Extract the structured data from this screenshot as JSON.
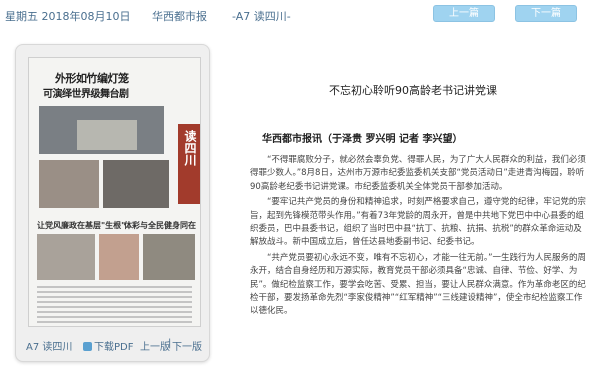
{
  "topbar": {
    "date": "星期五 2018年08月10日",
    "paper": "华西都市报",
    "edition": "-A7 读四川-",
    "prev_button": "上一篇",
    "next_button": "下一篇"
  },
  "thumbnail": {
    "headline1": "外形如竹编灯笼",
    "headline2": "可演绎世界级舞台剧",
    "section_stripe": "读四川",
    "sub_headline1": "让党风廉政在基层\"生根\"",
    "sub_headline2": "体彩与全民健身同在"
  },
  "panel_footer": {
    "edition_label": "A7 读四川",
    "download_pdf": "下载PDF",
    "prev_page": "上一版",
    "separator": "|",
    "next_page": "下一版"
  },
  "article": {
    "title": "不忘初心聆听90高龄老书记讲党课",
    "byline": "华西都市报讯（于泽贵 罗兴明 记者 李兴望）",
    "paragraphs": [
      "“不得罪腐败分子，就必然会辜负党、得罪人民，为了广大人民群众的利益，我们必须得罪少数人。”8月8日，达州市万源市纪委监委机关支部“党员活动日”走进青沟梅园，聆听90高龄老纪委书记讲党课。市纪委监委机关全体党员干部参加活动。",
      "“要牢记共产党员的身份和精神追求，时刻严格要求自己，遵守党的纪律，牢记党的宗旨，起到先锋模范带头作用。”有着73年党龄的周永开，曾是中共地下党巴中中心县委的组织委员，巴中县委书记，组织了当时巴中县“抗丁、抗粮、抗捐、抗税”的群众革命运动及解放战斗。新中国成立后，曾任达县地委副书记、纪委书记。",
      "“共产党员要初心永远不变，唯有不忘初心，才能一往无前。”一生践行为人民服务的周永开，结合自身经历和万源实际，教育党员干部必须具备“忠诚、自律、节俭、好学、为民”。做纪检监察工作，要学会吃苦、受累、担当，要让人民群众满意。作为革命老区的纪检干部，要发扬革命先烈“李家俊精神”“红军精神”“三线建设精神”，使全市纪检监察工作以德化民。"
    ]
  },
  "colors": {
    "link_blue": "#4a6f8f",
    "button_bg": "#9fd3f0",
    "stripe_red": "#a23b2c"
  },
  "icons": {
    "download": "download-icon"
  }
}
